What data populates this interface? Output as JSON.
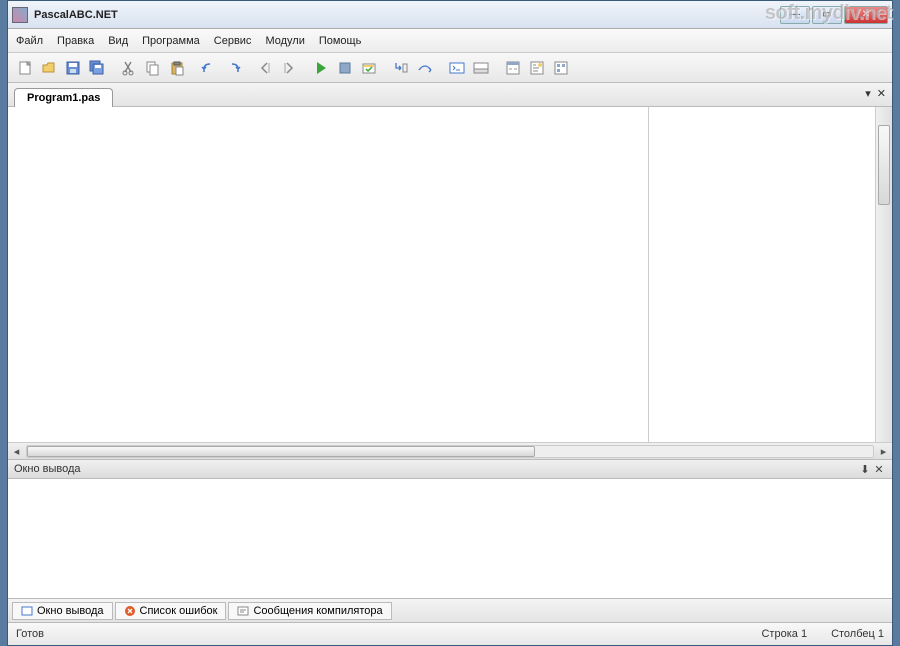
{
  "window": {
    "title": "PascalABC.NET"
  },
  "menu": {
    "file": "Файл",
    "edit": "Правка",
    "view": "Вид",
    "program": "Программа",
    "service": "Сервис",
    "modules": "Модули",
    "help": "Помощь"
  },
  "tabs": {
    "current": "Program1.pas"
  },
  "editor": {
    "content": ""
  },
  "output_panel": {
    "title": "Окно вывода"
  },
  "bottom_tabs": {
    "output": "Окно вывода",
    "errors": "Список ошибок",
    "compiler": "Сообщения компилятора"
  },
  "status": {
    "ready": "Готов",
    "line_label": "Строка",
    "line_value": "1",
    "col_label": "Столбец",
    "col_value": "1"
  },
  "watermark": "soft.mydiv.net"
}
